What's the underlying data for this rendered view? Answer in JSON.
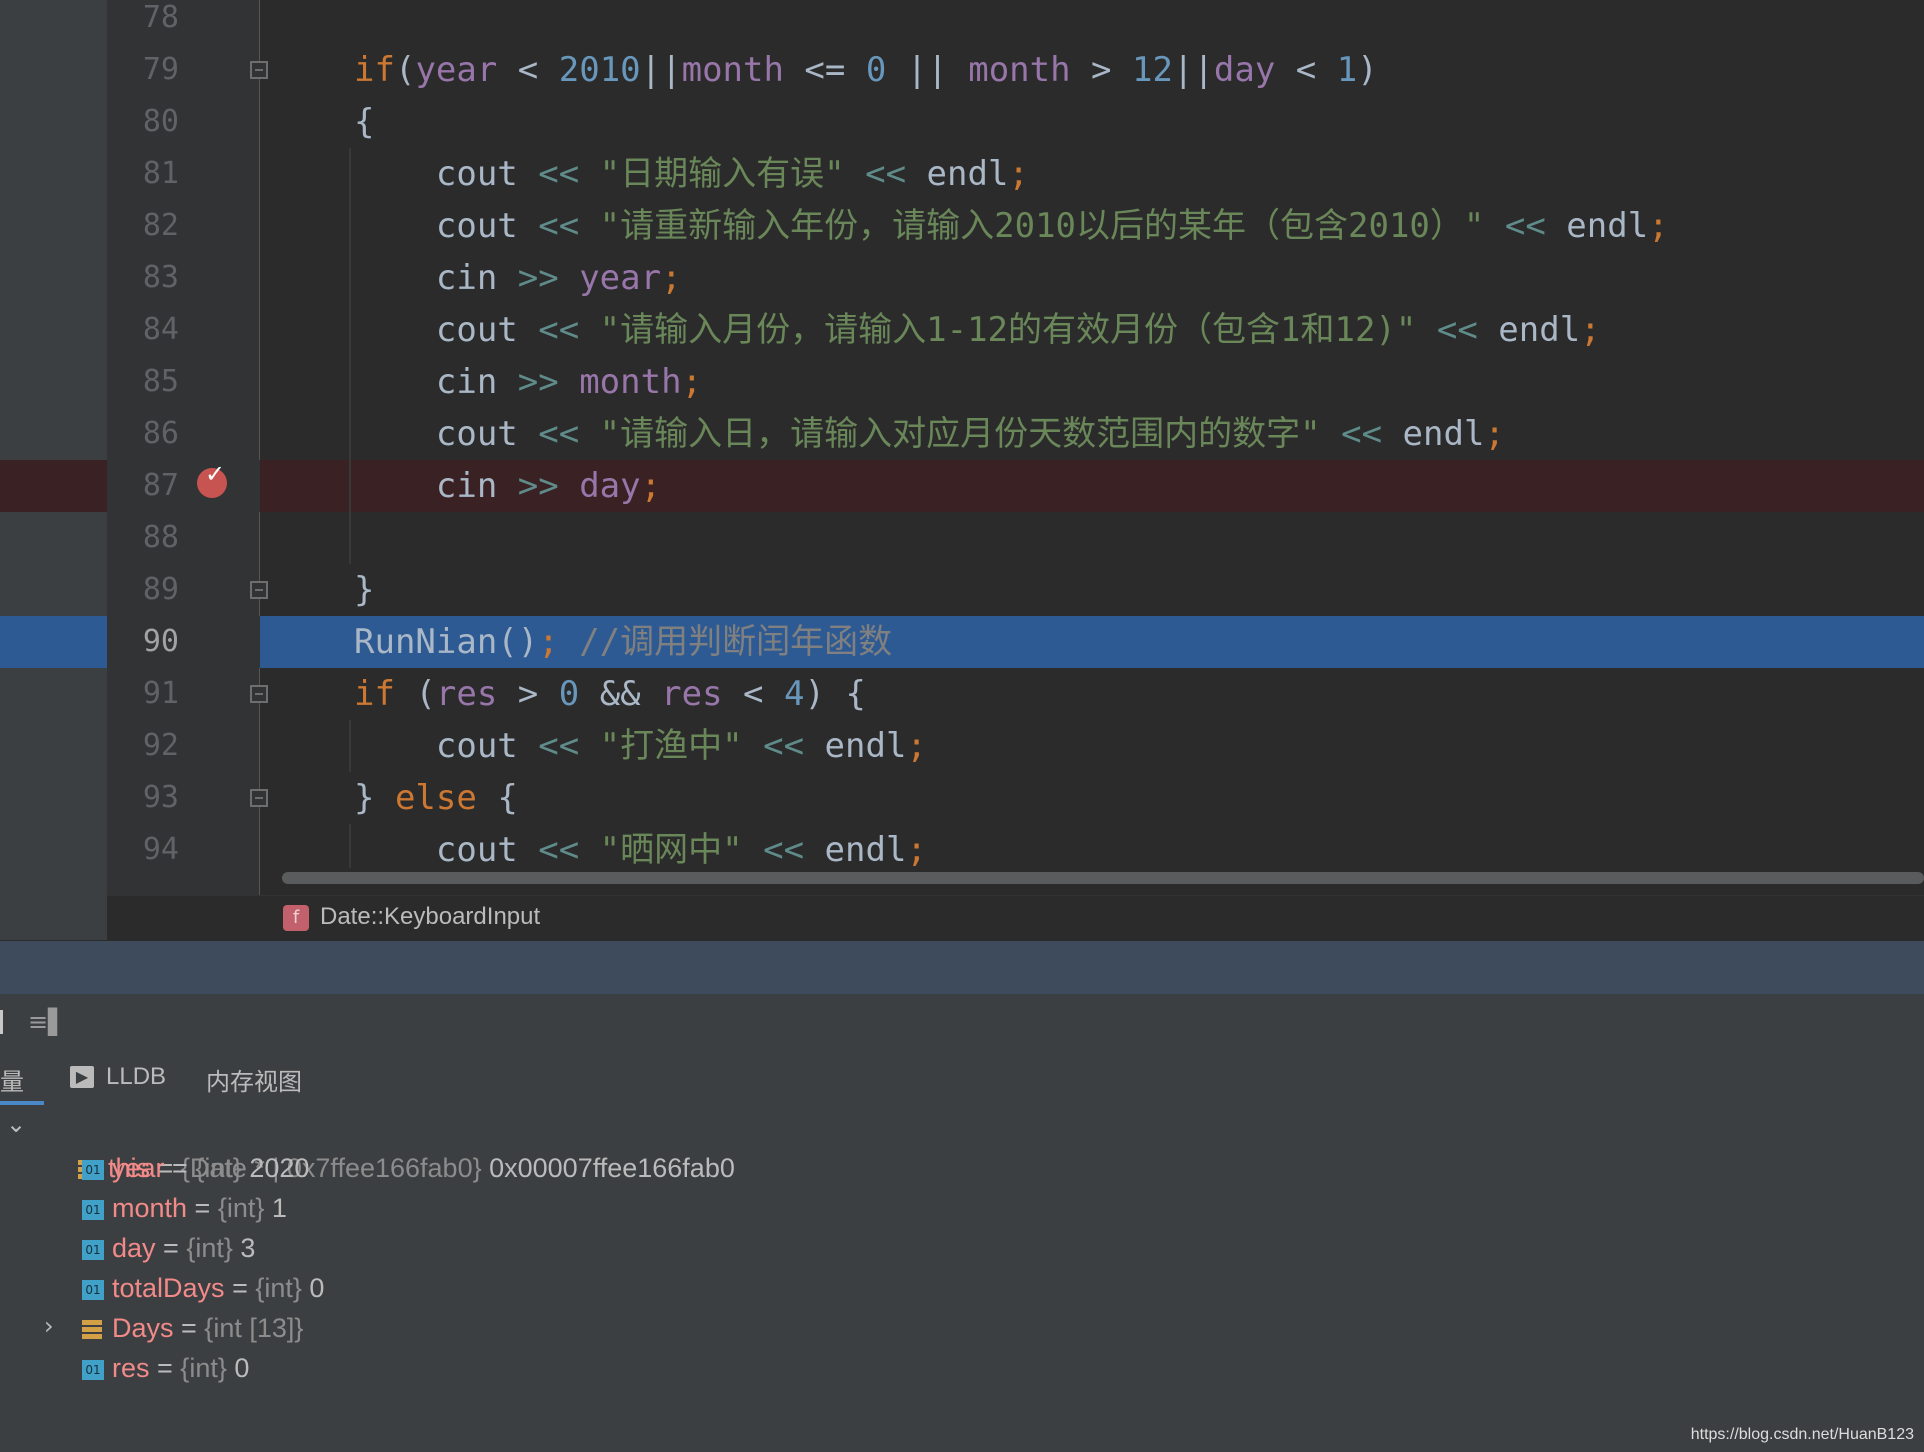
{
  "editor": {
    "lines": [
      {
        "num": "78",
        "tokens": []
      },
      {
        "num": "79",
        "tokens": [
          [
            "kw",
            "if"
          ],
          [
            "p",
            "("
          ],
          [
            "var",
            "year"
          ],
          [
            "p",
            " < "
          ],
          [
            "num",
            "2010"
          ],
          [
            "p",
            "||"
          ],
          [
            "var",
            "month"
          ],
          [
            "p",
            " <= "
          ],
          [
            "num",
            "0"
          ],
          [
            "p",
            " || "
          ],
          [
            "var",
            "month"
          ],
          [
            "p",
            " > "
          ],
          [
            "num",
            "12"
          ],
          [
            "p",
            "||"
          ],
          [
            "var",
            "day"
          ],
          [
            "p",
            " < "
          ],
          [
            "num",
            "1"
          ],
          [
            "p",
            ")"
          ]
        ]
      },
      {
        "num": "80",
        "tokens": [
          [
            "p",
            "{"
          ]
        ]
      },
      {
        "num": "81",
        "tokens": [
          [
            "p",
            "    cout "
          ],
          [
            "op",
            "<<"
          ],
          [
            "p",
            " "
          ],
          [
            "str",
            "\"日期输入有误\""
          ],
          [
            "p",
            " "
          ],
          [
            "op",
            "<<"
          ],
          [
            "p",
            " endl"
          ],
          [
            "semi",
            ";"
          ]
        ]
      },
      {
        "num": "82",
        "tokens": [
          [
            "p",
            "    cout "
          ],
          [
            "op",
            "<<"
          ],
          [
            "p",
            " "
          ],
          [
            "str",
            "\"请重新输入年份，请输入2010以后的某年（包含2010）\""
          ],
          [
            "p",
            " "
          ],
          [
            "op",
            "<<"
          ],
          [
            "p",
            " endl"
          ],
          [
            "semi",
            ";"
          ]
        ]
      },
      {
        "num": "83",
        "tokens": [
          [
            "p",
            "    cin "
          ],
          [
            "op",
            ">>"
          ],
          [
            "p",
            " "
          ],
          [
            "var",
            "year"
          ],
          [
            "semi",
            ";"
          ]
        ]
      },
      {
        "num": "84",
        "tokens": [
          [
            "p",
            "    cout "
          ],
          [
            "op",
            "<<"
          ],
          [
            "p",
            " "
          ],
          [
            "str",
            "\"请输入月份，请输入1-12的有效月份（包含1和12)\""
          ],
          [
            "p",
            " "
          ],
          [
            "op",
            "<<"
          ],
          [
            "p",
            " endl"
          ],
          [
            "semi",
            ";"
          ]
        ]
      },
      {
        "num": "85",
        "tokens": [
          [
            "p",
            "    cin "
          ],
          [
            "op",
            ">>"
          ],
          [
            "p",
            " "
          ],
          [
            "var",
            "month"
          ],
          [
            "semi",
            ";"
          ]
        ]
      },
      {
        "num": "86",
        "tokens": [
          [
            "p",
            "    cout "
          ],
          [
            "op",
            "<<"
          ],
          [
            "p",
            " "
          ],
          [
            "str",
            "\"请输入日，请输入对应月份天数范围内的数字\""
          ],
          [
            "p",
            " "
          ],
          [
            "op",
            "<<"
          ],
          [
            "p",
            " endl"
          ],
          [
            "semi",
            ";"
          ]
        ]
      },
      {
        "num": "87",
        "tokens": [
          [
            "p",
            "    cin "
          ],
          [
            "op",
            ">>"
          ],
          [
            "p",
            " "
          ],
          [
            "var",
            "day"
          ],
          [
            "semi",
            ";"
          ]
        ]
      },
      {
        "num": "88",
        "tokens": []
      },
      {
        "num": "89",
        "tokens": [
          [
            "p",
            "}"
          ]
        ]
      },
      {
        "num": "90",
        "tokens": [
          [
            "p",
            "RunNian()"
          ],
          [
            "semi",
            ";"
          ],
          [
            "p",
            " "
          ],
          [
            "cmt",
            "//调用判断闰年函数"
          ]
        ]
      },
      {
        "num": "91",
        "tokens": [
          [
            "kw",
            "if"
          ],
          [
            "p",
            " ("
          ],
          [
            "var",
            "res"
          ],
          [
            "p",
            " > "
          ],
          [
            "num",
            "0"
          ],
          [
            "p",
            " && "
          ],
          [
            "var",
            "res"
          ],
          [
            "p",
            " < "
          ],
          [
            "num",
            "4"
          ],
          [
            "p",
            ") {"
          ]
        ]
      },
      {
        "num": "92",
        "tokens": [
          [
            "p",
            "    cout "
          ],
          [
            "op",
            "<<"
          ],
          [
            "p",
            " "
          ],
          [
            "str",
            "\"打渔中\""
          ],
          [
            "p",
            " "
          ],
          [
            "op",
            "<<"
          ],
          [
            "p",
            " endl"
          ],
          [
            "semi",
            ";"
          ]
        ]
      },
      {
        "num": "93",
        "tokens": [
          [
            "p",
            "} "
          ],
          [
            "kw",
            "else"
          ],
          [
            "p",
            " {"
          ]
        ]
      },
      {
        "num": "94",
        "tokens": [
          [
            "p",
            "    cout "
          ],
          [
            "op",
            "<<"
          ],
          [
            "p",
            " "
          ],
          [
            "str",
            "\"晒网中\""
          ],
          [
            "p",
            " "
          ],
          [
            "op",
            "<<"
          ],
          [
            "p",
            " endl"
          ],
          [
            "semi",
            ";"
          ]
        ]
      }
    ],
    "breakpoint_line": "87",
    "execution_line": "90",
    "breadcrumb_icon": "f",
    "breadcrumb": "Date::KeyboardInput"
  },
  "debug": {
    "tabs": {
      "variables": "量",
      "lldb_icon": "terminal-icon",
      "lldb": "LLDB",
      "memory": "内存视图"
    },
    "this_row": {
      "name": "this",
      "eq": " = ",
      "type": "{Date * | 0x7ffee166fab0}",
      "value": " 0x00007ffee166fab0"
    },
    "fields": [
      {
        "name": "year",
        "type": "{int}",
        "value": "2020",
        "kind": "int"
      },
      {
        "name": "month",
        "type": "{int}",
        "value": "1",
        "kind": "int"
      },
      {
        "name": "day",
        "type": "{int}",
        "value": "3",
        "kind": "int"
      },
      {
        "name": "totalDays",
        "type": "{int}",
        "value": "0",
        "kind": "int"
      },
      {
        "name": "Days",
        "type": "{int [13]}",
        "value": "",
        "kind": "array"
      },
      {
        "name": "res",
        "type": "{int}",
        "value": "0",
        "kind": "int"
      }
    ],
    "int_icon_text": "01",
    "toolbar_icon": "≡▌"
  },
  "watermark": "https://blog.csdn.net/HuanB123",
  "colors": {
    "keyword": "#cc7832",
    "variable": "#9876aa",
    "number": "#6897bb",
    "string": "#6a8759",
    "breakpoint": "#c75450",
    "execution_highlight": "#2d5a93"
  }
}
